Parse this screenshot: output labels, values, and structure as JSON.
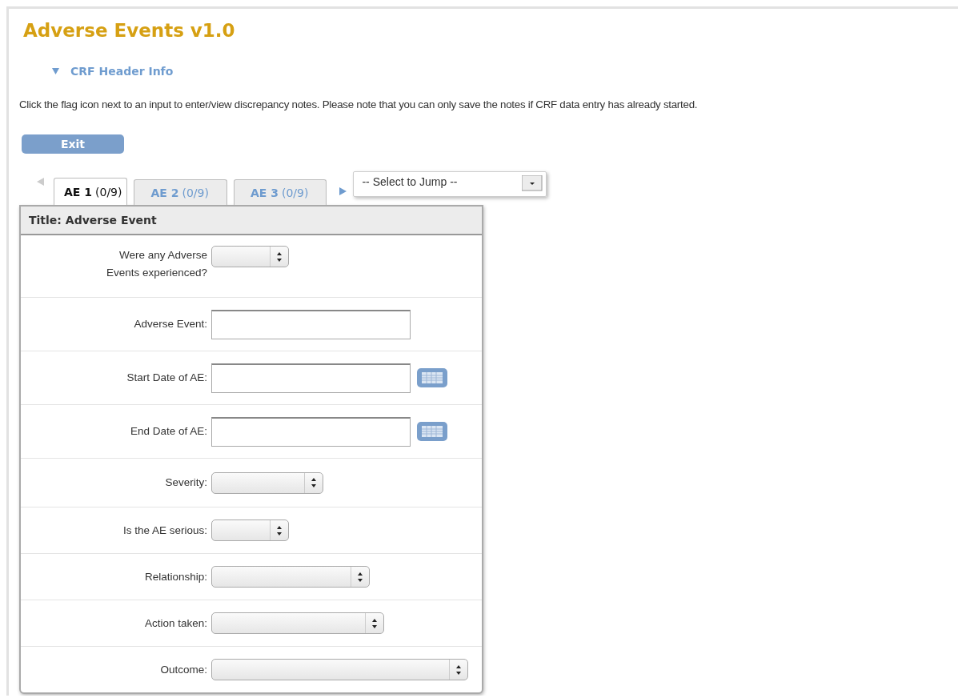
{
  "title": "Adverse Events v1.0",
  "header_toggle": {
    "label": "CRF Header Info",
    "expanded": true
  },
  "instruction": "Click the flag icon next to an input to enter/view discrepancy notes. Please note that you can only save the notes if CRF data entry has already started.",
  "exit_button": "Exit",
  "tabs": [
    {
      "name": "AE 1",
      "count": "(0/9)",
      "selected": true
    },
    {
      "name": "AE 2",
      "count": "(0/9)",
      "selected": false
    },
    {
      "name": "AE 3",
      "count": "(0/9)",
      "selected": false
    }
  ],
  "jump_select": {
    "placeholder": "-- Select to Jump --"
  },
  "section": {
    "title": "Title: Adverse Event",
    "fields": [
      {
        "label": "Were any Adverse Events experienced?",
        "kind": "select"
      },
      {
        "label": "Adverse Event:",
        "kind": "text"
      },
      {
        "label": "Start Date of AE:",
        "kind": "date"
      },
      {
        "label": "End Date of AE:",
        "kind": "date"
      },
      {
        "label": "Severity:",
        "kind": "select"
      },
      {
        "label": "Is the AE serious:",
        "kind": "select"
      },
      {
        "label": "Relationship:",
        "kind": "select"
      },
      {
        "label": "Action taken:",
        "kind": "select"
      },
      {
        "label": "Outcome:",
        "kind": "select"
      }
    ]
  }
}
